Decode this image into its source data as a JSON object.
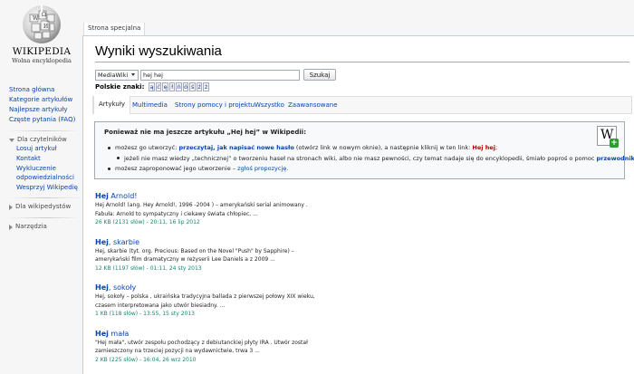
{
  "logo": {
    "title": "WIKIPEDIA",
    "subtitle": "Wolna encyklopedia"
  },
  "sidebar": {
    "main": [
      "Strona główna",
      "Kategorie artykułów",
      "Najlepsze artykuły",
      "Częste pytania (FAQ)"
    ],
    "readers_head": "Dla czytelników",
    "readers": [
      "Losuj artykuł",
      "Kontakt",
      "Wykluczenie odpowiedzialności",
      "Wesprzyj Wikipedię"
    ],
    "editors_head": "Dla wikipedystów",
    "tools_head": "Narzędzia"
  },
  "tab": {
    "label": "Strona specjalna"
  },
  "page": {
    "title": "Wyniki wyszukiwania"
  },
  "search": {
    "profile": "MediaWiki",
    "query": "hej hej",
    "button": "Szukaj",
    "chars_label": "Polskie znaki:",
    "chars": [
      "ą",
      "ć",
      "ę",
      "ł",
      "ń",
      "ó",
      "ś",
      "ź",
      "ż"
    ]
  },
  "type_tabs": [
    "Artykuły",
    "Multimedia",
    "Strony pomocy i projektu",
    "Wszystko",
    "Zaawansowane"
  ],
  "notice": {
    "title": "Ponieważ nie ma jeszcze artykułu „Hej hej” w Wikipedii:",
    "l1_a": "możesz go utworzyć: ",
    "l1_link": "przeczytaj, jak napisać nowe hasło",
    "l1_b": " (otwórz link w nowym oknie), a następnie kliknij w ten link: ",
    "l1_red": "Hej hej",
    "l1_c": ";",
    "l2_a": "jeżeli nie masz wiedzy „technicznej” o tworzeniu haseł na stronach wiki, albo nie masz pewności, czy temat nadaje się do encyklopedii, śmiało poproś o pomoc ",
    "l2_link": "przewodnika",
    "l2_b": ";",
    "l3_a": "możesz zaproponować jego utworzenie – ",
    "l3_link": "zgłoś propozycję",
    "l3_b": "."
  },
  "results": [
    {
      "bold": "Hej",
      "rest": " Arnold!",
      "snippet1": "Hej Arnold! (ang. Hey Arnold!, 1996 -2004 ) – amerykański serial animowany .",
      "snippet2": "Fabuła: Arnold to sympatyczny i ciekawy świata chłopiec, ...",
      "meta": "26 KB (2131 słów) - 20:11, 16 lip 2012"
    },
    {
      "bold": "Hej",
      "rest": ", skarbie",
      "snippet1": "Hej, skarbie (tyt. org. Precious: Based on the Novel \"Push\" by Sapphire) –",
      "snippet2": "amerykański film dramatyczny w reżyserii Lee Daniels a z 2009 ...",
      "meta": "12 KB (1197 słów) - 01:11, 24 sty 2013"
    },
    {
      "bold": "Hej",
      "rest": ", sokoły",
      "snippet1": "Hej, sokoły – polska , ukraińska tradycyjna ballada z pierwszej połowy XIX wieku,",
      "snippet2": "czasem interpretowana jako utwór biesiadny. ...",
      "meta": "1 KB (118 słów) - 13:55, 15 sty 2013"
    },
    {
      "bold": "Hej",
      "rest": " mała",
      "snippet1": "\"Hej mała\", utwór zespołu pochodzący z debiutanckiej płyty IRA . Utwór został",
      "snippet2": "zamieszczony na trzeciej pozycji na wydawnictwie, trwa 3 ...",
      "meta": "2 KB (225 słów) - 16:04, 26 wrz 2010"
    }
  ],
  "colors": {
    "link": "#0645ad",
    "redlink": "#ba0000",
    "meta": "#14866d",
    "content_border": "#a7d7f9"
  }
}
